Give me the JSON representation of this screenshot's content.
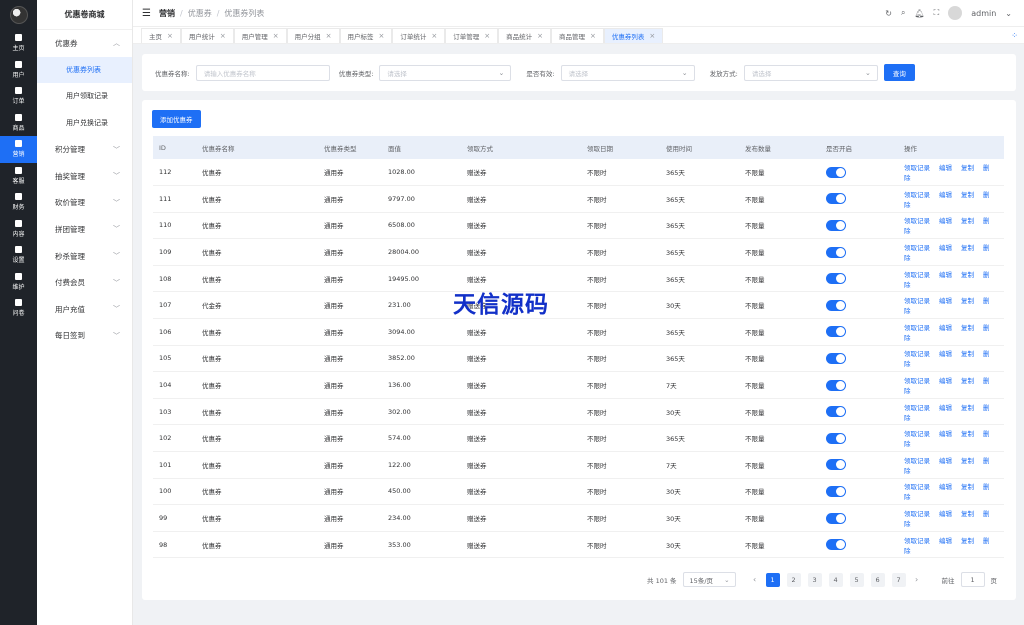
{
  "sidebar": {
    "rail": [
      {
        "label": "主页",
        "active": false
      },
      {
        "label": "用户",
        "active": false
      },
      {
        "label": "订单",
        "active": false
      },
      {
        "label": "商品",
        "active": false
      },
      {
        "label": "营销",
        "active": true
      },
      {
        "label": "客服",
        "active": false
      },
      {
        "label": "财务",
        "active": false
      },
      {
        "label": "内容",
        "active": false
      },
      {
        "label": "设置",
        "active": false
      },
      {
        "label": "维护",
        "active": false
      },
      {
        "label": "问卷",
        "active": false
      }
    ]
  },
  "menu": {
    "title": "优惠卷商城",
    "groups": [
      {
        "label": "优惠券",
        "expanded": true,
        "children": [
          "优惠券列表",
          "用户领取记录",
          "用户兑换记录"
        ]
      },
      {
        "label": "积分管理"
      },
      {
        "label": "抽奖管理"
      },
      {
        "label": "砍价管理"
      },
      {
        "label": "拼团管理"
      },
      {
        "label": "秒杀管理"
      },
      {
        "label": "付费会员"
      },
      {
        "label": "用户充值"
      },
      {
        "label": "每日签到"
      }
    ]
  },
  "header": {
    "breadcrumb": [
      "营销",
      "优惠券",
      "优惠券列表"
    ],
    "user": "admin"
  },
  "tabs": [
    "主页",
    "用户统计",
    "用户管理",
    "用户分组",
    "用户标签",
    "订单统计",
    "订单管理",
    "商品统计",
    "商品管理",
    "优惠券列表"
  ],
  "filter": {
    "name_label": "优惠券名称:",
    "name_placeholder": "请输入优惠券名称",
    "type_label": "优惠券类型:",
    "type_placeholder": "请选择",
    "valid_label": "是否有效:",
    "valid_placeholder": "请选择",
    "method_label": "发放方式:",
    "method_placeholder": "请选择",
    "search_button": "查询"
  },
  "add_button": "添加优惠券",
  "table": {
    "columns": [
      "ID",
      "优惠券名称",
      "优惠券类型",
      "面值",
      "领取方式",
      "领取日期",
      "使用时间",
      "发布数量",
      "是否开启",
      "操作"
    ],
    "actions": [
      "领取记录",
      "编辑",
      "复制",
      "删除"
    ],
    "rows": [
      {
        "id": "112",
        "name": "优惠券",
        "type": "通用券",
        "value": "1028.00",
        "method": "赠送券",
        "date": "不限时",
        "use": "365天",
        "qty": "不限量",
        "on": true
      },
      {
        "id": "111",
        "name": "优惠券",
        "type": "通用券",
        "value": "9797.00",
        "method": "赠送券",
        "date": "不限时",
        "use": "365天",
        "qty": "不限量",
        "on": true
      },
      {
        "id": "110",
        "name": "优惠券",
        "type": "通用券",
        "value": "6508.00",
        "method": "赠送券",
        "date": "不限时",
        "use": "365天",
        "qty": "不限量",
        "on": true
      },
      {
        "id": "109",
        "name": "优惠券",
        "type": "通用券",
        "value": "28004.00",
        "method": "赠送券",
        "date": "不限时",
        "use": "365天",
        "qty": "不限量",
        "on": true
      },
      {
        "id": "108",
        "name": "优惠券",
        "type": "通用券",
        "value": "19495.00",
        "method": "赠送券",
        "date": "不限时",
        "use": "365天",
        "qty": "不限量",
        "on": true
      },
      {
        "id": "107",
        "name": "代金券",
        "type": "通用券",
        "value": "231.00",
        "method": "赠送券",
        "date": "不限时",
        "use": "30天",
        "qty": "不限量",
        "on": true
      },
      {
        "id": "106",
        "name": "优惠券",
        "type": "通用券",
        "value": "3094.00",
        "method": "赠送券",
        "date": "不限时",
        "use": "365天",
        "qty": "不限量",
        "on": true
      },
      {
        "id": "105",
        "name": "优惠券",
        "type": "通用券",
        "value": "3852.00",
        "method": "赠送券",
        "date": "不限时",
        "use": "365天",
        "qty": "不限量",
        "on": true
      },
      {
        "id": "104",
        "name": "优惠券",
        "type": "通用券",
        "value": "136.00",
        "method": "赠送券",
        "date": "不限时",
        "use": "7天",
        "qty": "不限量",
        "on": true
      },
      {
        "id": "103",
        "name": "优惠券",
        "type": "通用券",
        "value": "302.00",
        "method": "赠送券",
        "date": "不限时",
        "use": "30天",
        "qty": "不限量",
        "on": true
      },
      {
        "id": "102",
        "name": "优惠券",
        "type": "通用券",
        "value": "574.00",
        "method": "赠送券",
        "date": "不限时",
        "use": "365天",
        "qty": "不限量",
        "on": true
      },
      {
        "id": "101",
        "name": "优惠券",
        "type": "通用券",
        "value": "122.00",
        "method": "赠送券",
        "date": "不限时",
        "use": "7天",
        "qty": "不限量",
        "on": true
      },
      {
        "id": "100",
        "name": "优惠券",
        "type": "通用券",
        "value": "450.00",
        "method": "赠送券",
        "date": "不限时",
        "use": "30天",
        "qty": "不限量",
        "on": true
      },
      {
        "id": "99",
        "name": "优惠券",
        "type": "通用券",
        "value": "234.00",
        "method": "赠送券",
        "date": "不限时",
        "use": "30天",
        "qty": "不限量",
        "on": true
      },
      {
        "id": "98",
        "name": "优惠券",
        "type": "通用券",
        "value": "353.00",
        "method": "赠送券",
        "date": "不限时",
        "use": "30天",
        "qty": "不限量",
        "on": true
      }
    ]
  },
  "pagination": {
    "total": "共 101 条",
    "page_size": "15条/页",
    "pages": [
      "1",
      "2",
      "3",
      "4",
      "5",
      "6",
      "7"
    ],
    "current": "1",
    "goto_label": "前往",
    "goto_value": "1",
    "goto_suffix": "页"
  },
  "watermark": "天信源码",
  "colors": {
    "primary": "#1e6ff5",
    "rail_bg": "#1f2329",
    "header_row": "#e9eff9"
  }
}
